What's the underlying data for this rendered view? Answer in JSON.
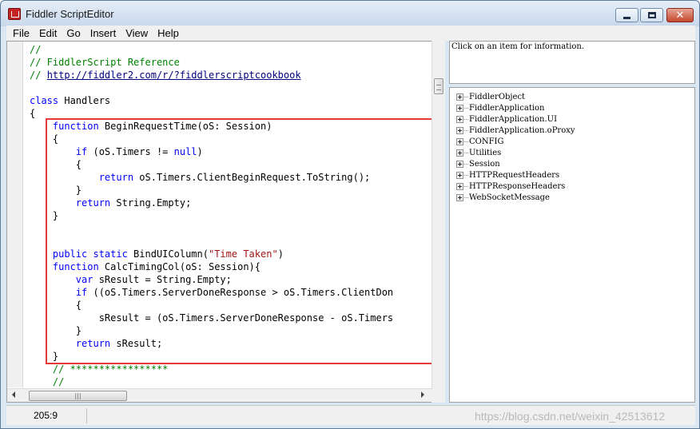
{
  "window": {
    "title": "Fiddler ScriptEditor"
  },
  "menu": [
    "File",
    "Edit",
    "Go",
    "Insert",
    "View",
    "Help"
  ],
  "code_lines": [
    [
      {
        "c": "cm",
        "t": "//"
      }
    ],
    [
      {
        "c": "cm",
        "t": "// FiddlerScript Reference"
      }
    ],
    [
      {
        "c": "cm",
        "t": "// "
      },
      {
        "c": "link",
        "t": "http://fiddler2.com/r/?fiddlerscriptcookbook"
      }
    ],
    [],
    [
      {
        "c": "kw",
        "t": "class"
      },
      {
        "c": "tx",
        "t": " Handlers"
      }
    ],
    [
      {
        "c": "tx",
        "t": "{"
      }
    ],
    [
      {
        "c": "tx",
        "t": "    "
      },
      {
        "c": "kw",
        "t": "function"
      },
      {
        "c": "tx",
        "t": " BeginRequestTime(oS: Session)"
      }
    ],
    [
      {
        "c": "tx",
        "t": "    {"
      }
    ],
    [
      {
        "c": "tx",
        "t": "        "
      },
      {
        "c": "kw",
        "t": "if"
      },
      {
        "c": "tx",
        "t": " (oS.Timers != "
      },
      {
        "c": "kw",
        "t": "null"
      },
      {
        "c": "tx",
        "t": ")"
      }
    ],
    [
      {
        "c": "tx",
        "t": "        {"
      }
    ],
    [
      {
        "c": "tx",
        "t": "            "
      },
      {
        "c": "kw",
        "t": "return"
      },
      {
        "c": "tx",
        "t": " oS.Timers.ClientBeginRequest.ToString();"
      }
    ],
    [
      {
        "c": "tx",
        "t": "        }"
      }
    ],
    [
      {
        "c": "tx",
        "t": "        "
      },
      {
        "c": "kw",
        "t": "return"
      },
      {
        "c": "tx",
        "t": " String.Empty;"
      }
    ],
    [
      {
        "c": "tx",
        "t": "    }"
      }
    ],
    [],
    [],
    [
      {
        "c": "tx",
        "t": "    "
      },
      {
        "c": "kw",
        "t": "public static"
      },
      {
        "c": "tx",
        "t": " BindUIColumn("
      },
      {
        "c": "st",
        "t": "\"Time Taken\""
      },
      {
        "c": "tx",
        "t": ")"
      }
    ],
    [
      {
        "c": "tx",
        "t": "    "
      },
      {
        "c": "kw",
        "t": "function"
      },
      {
        "c": "tx",
        "t": " CalcTimingCol(oS: Session){"
      }
    ],
    [
      {
        "c": "tx",
        "t": "        "
      },
      {
        "c": "kw",
        "t": "var"
      },
      {
        "c": "tx",
        "t": " sResult = String.Empty;"
      }
    ],
    [
      {
        "c": "tx",
        "t": "        "
      },
      {
        "c": "kw",
        "t": "if"
      },
      {
        "c": "tx",
        "t": " ((oS.Timers.ServerDoneResponse > oS.Timers.ClientDon"
      }
    ],
    [
      {
        "c": "tx",
        "t": "        {"
      }
    ],
    [
      {
        "c": "tx",
        "t": "            sResult = (oS.Timers.ServerDoneResponse - oS.Timers"
      }
    ],
    [
      {
        "c": "tx",
        "t": "        }"
      }
    ],
    [
      {
        "c": "tx",
        "t": "        "
      },
      {
        "c": "kw",
        "t": "return"
      },
      {
        "c": "tx",
        "t": " sResult;"
      }
    ],
    [
      {
        "c": "tx",
        "t": "    }"
      }
    ],
    [
      {
        "c": "tx",
        "t": "    "
      },
      {
        "c": "cm",
        "t": "// *****************"
      }
    ],
    [
      {
        "c": "tx",
        "t": "    "
      },
      {
        "c": "cm",
        "t": "//"
      }
    ]
  ],
  "info_pane": {
    "text": "Click on an item for information."
  },
  "tree_items": [
    "FiddlerObject",
    "FiddlerApplication",
    "FiddlerApplication.UI",
    "FiddlerApplication.oProxy",
    "CONFIG",
    "Utilities",
    "Session",
    "HTTPRequestHeaders",
    "HTTPResponseHeaders",
    "WebSocketMessage"
  ],
  "statusbar": {
    "position": "205:9"
  },
  "watermark": "https://blog.csdn.net/weixin_42513612",
  "colors": {
    "highlight_border": "#e53935",
    "comment": "#008000",
    "keyword": "#0000ff",
    "string": "#a31515"
  }
}
